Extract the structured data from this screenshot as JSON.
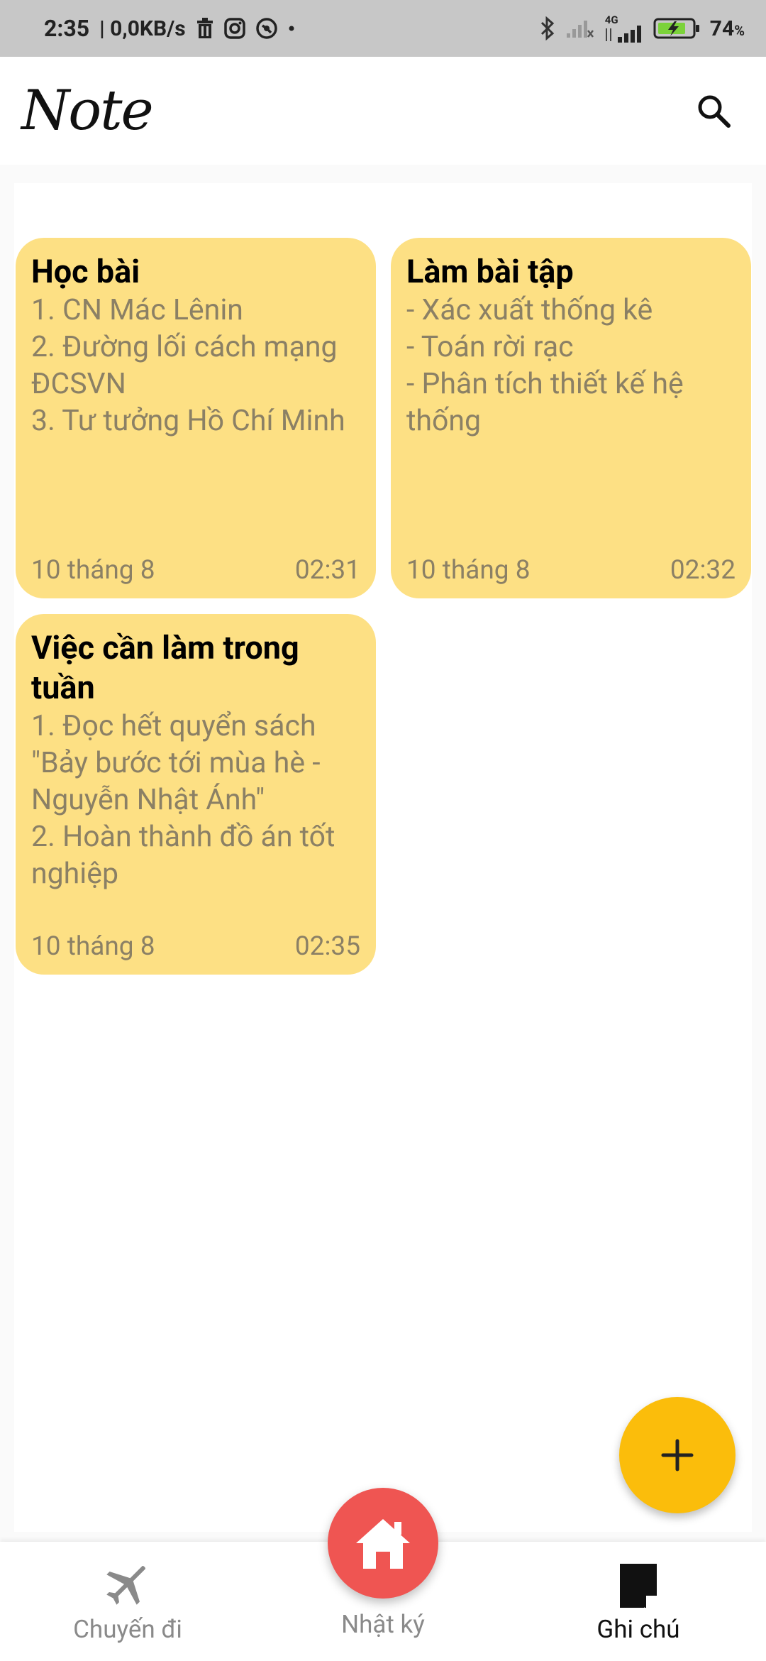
{
  "status_bar": {
    "time": "2:35",
    "speed": "| 0,0KB/s",
    "network_label": "4G",
    "battery": "74",
    "battery_unit": "%"
  },
  "app": {
    "logo": "Note"
  },
  "notes": [
    {
      "title": "Học bài",
      "body": "1. CN Mác Lênin\n2. Đường lối cách mạng ĐCSVN\n3. Tư tưởng Hồ Chí Minh",
      "date": "10 tháng 8",
      "time": "02:31"
    },
    {
      "title": "Làm bài tập",
      "body": "- Xác xuất thống kê\n- Toán rời rạc\n- Phân tích thiết kế hệ thống",
      "date": "10 tháng 8",
      "time": "02:32"
    },
    {
      "title": "Việc cần làm trong tuần",
      "body": "1. Đọc hết quyển sách \"Bảy bước tới mùa hè - Nguyễn Nhật Ánh\"\n2. Hoàn thành đồ án tốt nghiệp",
      "date": "10 tháng 8",
      "time": "02:35"
    }
  ],
  "nav": {
    "trips": "Chuyến đi",
    "diary": "Nhật ký",
    "notes": "Ghi chú"
  },
  "colors": {
    "card": "#fde084",
    "fab": "#fbbd0b",
    "home": "#ef5552"
  }
}
